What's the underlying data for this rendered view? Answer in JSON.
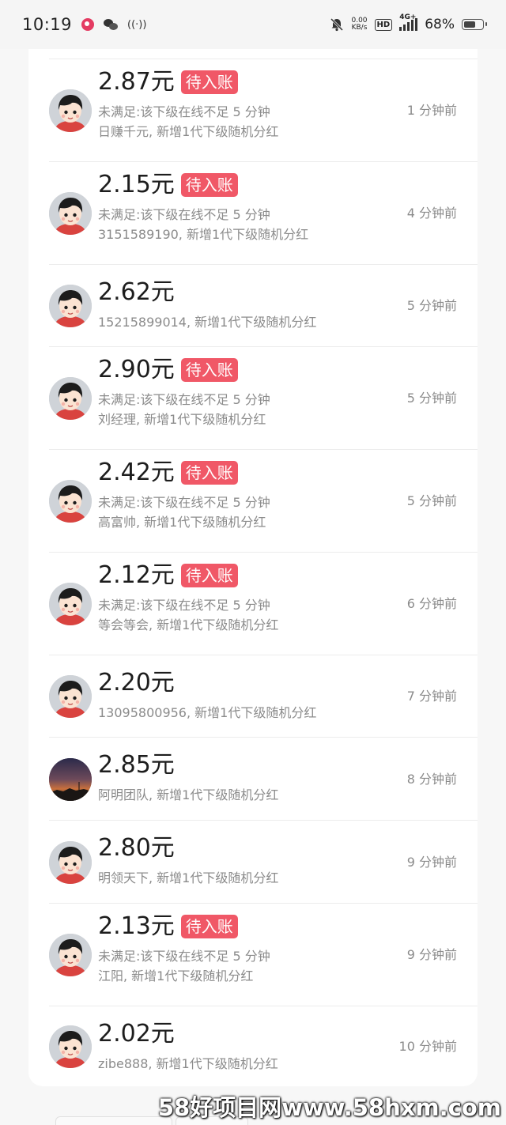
{
  "status_bar": {
    "time": "10:19",
    "speed_value": "0.00",
    "speed_unit": "KB/s",
    "hd_label": "HD",
    "network_label": "4G+",
    "battery": "68%",
    "battery_level": 0.68
  },
  "items": [
    {
      "amount": "2.87元",
      "badge": "待入账",
      "line1": "未满足:该下级在线不足 5 分钟",
      "line2": "日赚千元, 新增1代下级随机分红",
      "time": "1 分钟前",
      "avatar": "cartoon-avatar"
    },
    {
      "amount": "2.15元",
      "badge": "待入账",
      "line1": "未满足:该下级在线不足 5 分钟",
      "line2": "3151589190, 新增1代下级随机分红",
      "time": "4 分钟前",
      "avatar": "cartoon-avatar"
    },
    {
      "amount": "2.62元",
      "badge": "",
      "line1": "15215899014, 新增1代下级随机分红",
      "line2": "",
      "time": "5 分钟前",
      "avatar": "cartoon-avatar"
    },
    {
      "amount": "2.90元",
      "badge": "待入账",
      "line1": "未满足:该下级在线不足 5 分钟",
      "line2": "刘经理, 新增1代下级随机分红",
      "time": "5 分钟前",
      "avatar": "cartoon-avatar"
    },
    {
      "amount": "2.42元",
      "badge": "待入账",
      "line1": "未满足:该下级在线不足 5 分钟",
      "line2": "高富帅, 新增1代下级随机分红",
      "time": "5 分钟前",
      "avatar": "cartoon-avatar"
    },
    {
      "amount": "2.12元",
      "badge": "待入账",
      "line1": "未满足:该下级在线不足 5 分钟",
      "line2": "等会等会, 新增1代下级随机分红",
      "time": "6 分钟前",
      "avatar": "cartoon-avatar"
    },
    {
      "amount": "2.20元",
      "badge": "",
      "line1": "13095800956, 新增1代下级随机分红",
      "line2": "",
      "time": "7 分钟前",
      "avatar": "cartoon-avatar"
    },
    {
      "amount": "2.85元",
      "badge": "",
      "line1": "阿明团队, 新增1代下级随机分红",
      "line2": "",
      "time": "8 分钟前",
      "avatar": "sunset-photo-avatar"
    },
    {
      "amount": "2.80元",
      "badge": "",
      "line1": "明领天下, 新增1代下级随机分红",
      "line2": "",
      "time": "9 分钟前",
      "avatar": "cartoon-avatar"
    },
    {
      "amount": "2.13元",
      "badge": "待入账",
      "line1": "未满足:该下级在线不足 5 分钟",
      "line2": "江阳, 新增1代下级随机分红",
      "time": "9 分钟前",
      "avatar": "cartoon-avatar"
    },
    {
      "amount": "2.02元",
      "badge": "",
      "line1": "zibe888, 新增1代下级随机分红",
      "line2": "",
      "time": "10 分钟前",
      "avatar": "cartoon-avatar"
    }
  ],
  "watermark": "58好项目网www.58hxm.com"
}
